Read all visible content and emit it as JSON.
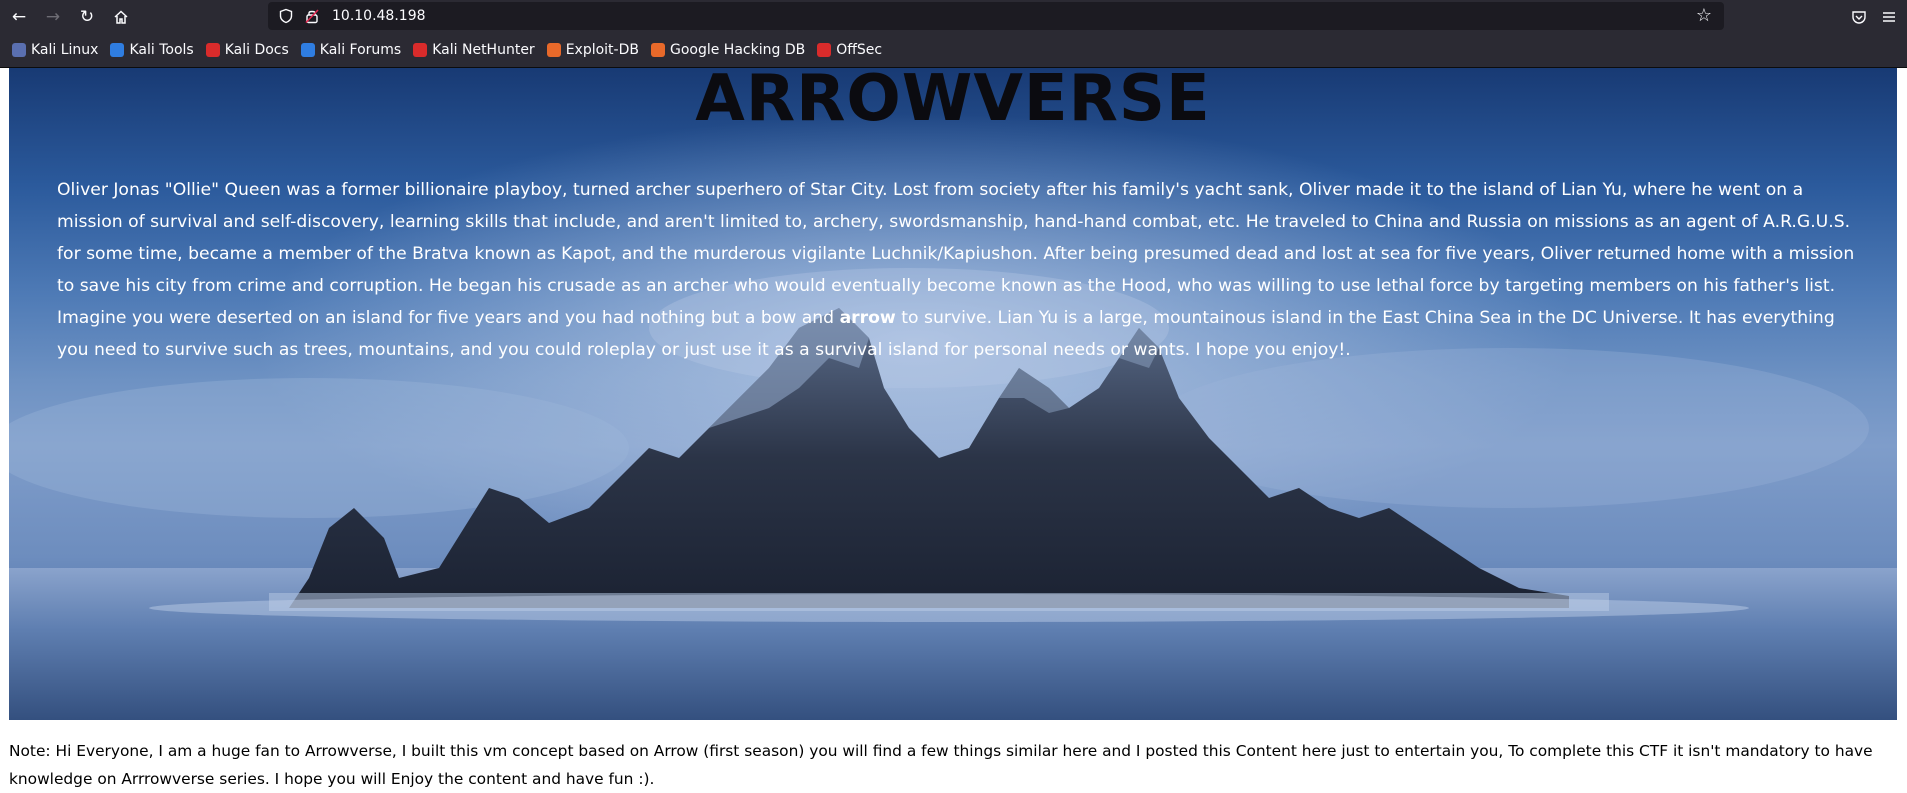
{
  "browser": {
    "url": "10.10.48.198",
    "nav": {
      "back_icon": "arrow-left-icon",
      "forward_icon": "arrow-right-icon",
      "reload_icon": "reload-icon",
      "home_icon": "home-icon"
    },
    "bookmarks": [
      {
        "label": "Kali Linux",
        "icon": "kali-dragon-icon",
        "color": "#5a6fb0"
      },
      {
        "label": "Kali Tools",
        "icon": "kali-tools-icon",
        "color": "#2f7de1"
      },
      {
        "label": "Kali Docs",
        "icon": "kali-docs-icon",
        "color": "#d92b2b"
      },
      {
        "label": "Kali Forums",
        "icon": "kali-forums-icon",
        "color": "#2f7de1"
      },
      {
        "label": "Kali NetHunter",
        "icon": "kali-nethunter-icon",
        "color": "#d92b2b"
      },
      {
        "label": "Exploit-DB",
        "icon": "exploit-db-icon",
        "color": "#e8692a"
      },
      {
        "label": "Google Hacking DB",
        "icon": "ghdb-icon",
        "color": "#e8692a"
      },
      {
        "label": "OffSec",
        "icon": "offsec-icon",
        "color": "#d92b2b"
      }
    ]
  },
  "page": {
    "title": "ARROWVERSE",
    "paragraph_before": "Oliver Jonas \"Ollie\" Queen was a former billionaire playboy, turned archer superhero of Star City. Lost from society after his family's yacht sank, Oliver made it to the island of Lian Yu, where he went on a mission of survival and self-discovery, learning skills that include, and aren't limited to, archery, swordsmanship, hand-hand combat, etc. He traveled to China and Russia on missions as an agent of A.R.G.U.S. for some time, became a member of the Bratva known as Kapot, and the murderous vigilante Luchnik/Kapiushon. After being presumed dead and lost at sea for five years, Oliver returned home with a mission to save his city from crime and corruption. He began his crusade as an archer who would eventually become known as the Hood, who was willing to use lethal force by targeting members on his father's list. Imagine you were deserted on an island for five years and you had nothing but a bow and ",
    "paragraph_bold": "arrow",
    "paragraph_after": " to survive. Lian Yu is a large, mountainous island in the East China Sea in the DC Universe. It has everything you need to survive such as trees, mountains, and you could roleplay or just use it as a survival island for personal needs or wants. I hope you enjoy!.",
    "note": "Note: Hi Everyone, I am a huge fan to Arrowverse, I built this vm concept based on Arrow (first season) you will find a few things similar here and I posted this Content here just to entertain you, To complete this CTF it isn't mandatory to have knowledge on Arrrowverse series. I hope you will Enjoy the content and have fun :)."
  }
}
